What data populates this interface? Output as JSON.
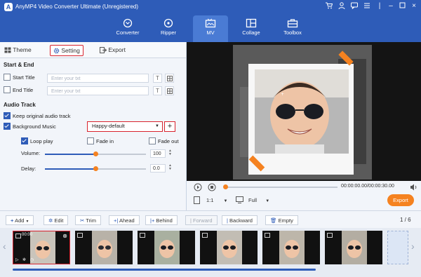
{
  "app": {
    "title": "AnyMP4 Video Converter Ultimate (Unregistered)"
  },
  "nav": {
    "tabs": [
      {
        "label": "Converter",
        "icon": "converter-icon"
      },
      {
        "label": "Ripper",
        "icon": "ripper-icon"
      },
      {
        "label": "MV",
        "icon": "mv-icon"
      },
      {
        "label": "Collage",
        "icon": "collage-icon"
      },
      {
        "label": "Toolbox",
        "icon": "toolbox-icon"
      }
    ],
    "active": "MV"
  },
  "subtabs": {
    "theme": "Theme",
    "setting": "Setting",
    "export": "Export"
  },
  "start_end": {
    "heading": "Start & End",
    "start_label": "Start Title",
    "start_placeholder": "Enter your txt",
    "end_label": "End Title",
    "end_placeholder": "Enter your txt",
    "t_button": "T"
  },
  "audio": {
    "heading": "Audio Track",
    "keep_original": "Keep original audio track",
    "background_music": "Background Music",
    "music_value": "Happy-default",
    "add": "+",
    "loop_play": "Loop play",
    "fade_in": "Fade in",
    "fade_out": "Fade out",
    "volume_label": "Volume:",
    "volume_value": "100",
    "volume_level": 1.0,
    "delay_label": "Delay:",
    "delay_value": "0.0",
    "delay_level": 0.5
  },
  "player": {
    "time": "00:00:00.00/00:00:30.00",
    "ratio": "1:1",
    "mode": "Full",
    "export": "Export",
    "progress": 0.0
  },
  "timeline": {
    "add": "Add",
    "edit": "Edit",
    "trim": "Trim",
    "ahead": "Ahead",
    "behind": "Behind",
    "forward": "Forward",
    "backward": "Backward",
    "empty": "Empty",
    "page": "1 / 6",
    "first_clip_time": "00:00"
  },
  "colors": {
    "accent": "#2e5cb8",
    "highlight": "#d9232e",
    "export": "#f58220"
  }
}
